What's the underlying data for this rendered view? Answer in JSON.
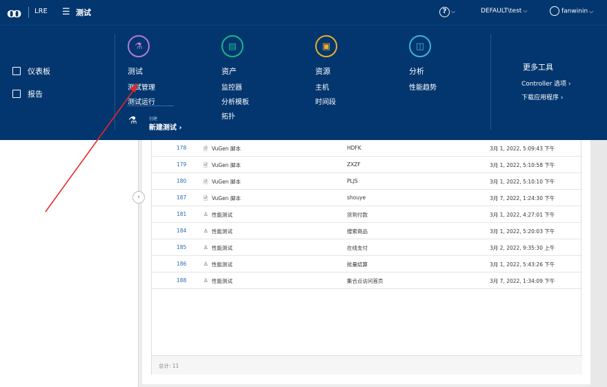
{
  "topbar": {
    "logo": "ꝏ",
    "product": "LRE",
    "section": "测试",
    "tenant": "DEFAULT\\test",
    "user": "fanwinin"
  },
  "leftnav": {
    "items": [
      {
        "label": "仪表板",
        "icon": "dashboard-icon"
      },
      {
        "label": "报告",
        "icon": "report-icon"
      }
    ]
  },
  "menu": {
    "test": {
      "title": "测试",
      "items": [
        "测试管理",
        "测试运行"
      ],
      "icon": "flask-icon",
      "color": "#b67adf"
    },
    "assets": {
      "title": "资产",
      "items": [
        "监控器",
        "分析模板",
        "拓扑"
      ],
      "icon": "monitor-icon",
      "color": "#1fb58a"
    },
    "resources": {
      "title": "资源",
      "items": [
        "主机",
        "时间段"
      ],
      "icon": "host-icon",
      "color": "#e8b22c"
    },
    "analysis": {
      "title": "分析",
      "items": [
        "性能趋势"
      ],
      "icon": "chart-icon",
      "color": "#3db7d6"
    },
    "create": {
      "small": "创建",
      "label": "新建测试 ›"
    },
    "more_tools": {
      "title": "更多工具",
      "items": [
        "Controller 选项 ›",
        "下载应用程序 ›"
      ]
    }
  },
  "table": {
    "rows": [
      {
        "id": "178",
        "type": "VuGen 脚本",
        "name": "HDFK",
        "date": "3月 1, 2022, 5:09:43 下午"
      },
      {
        "id": "179",
        "type": "VuGen 脚本",
        "name": "ZXZF",
        "date": "3月 1, 2022, 5:10:58 下午"
      },
      {
        "id": "180",
        "type": "VuGen 脚本",
        "name": "PLJS",
        "date": "3月 1, 2022, 5:10:10 下午"
      },
      {
        "id": "187",
        "type": "VuGen 脚本",
        "name": "shouye",
        "date": "3月 7, 2022, 1:24:30 下午"
      },
      {
        "id": "181",
        "type": "性能测试",
        "name": "货到付款",
        "date": "3月 1, 2022, 4:27:01 下午"
      },
      {
        "id": "184",
        "type": "性能测试",
        "name": "搜索商品",
        "date": "3月 1, 2022, 5:20:03 下午"
      },
      {
        "id": "185",
        "type": "性能测试",
        "name": "在线支付",
        "date": "3月 2, 2022, 9:35:30 上午"
      },
      {
        "id": "186",
        "type": "性能测试",
        "name": "批量结算",
        "date": "3月 1, 2022, 5:43:26 下午"
      },
      {
        "id": "188",
        "type": "性能测试",
        "name": "集合点访问首页",
        "date": "3月 7, 2022, 1:34:09 下午"
      }
    ],
    "footer": "总计: 11"
  }
}
